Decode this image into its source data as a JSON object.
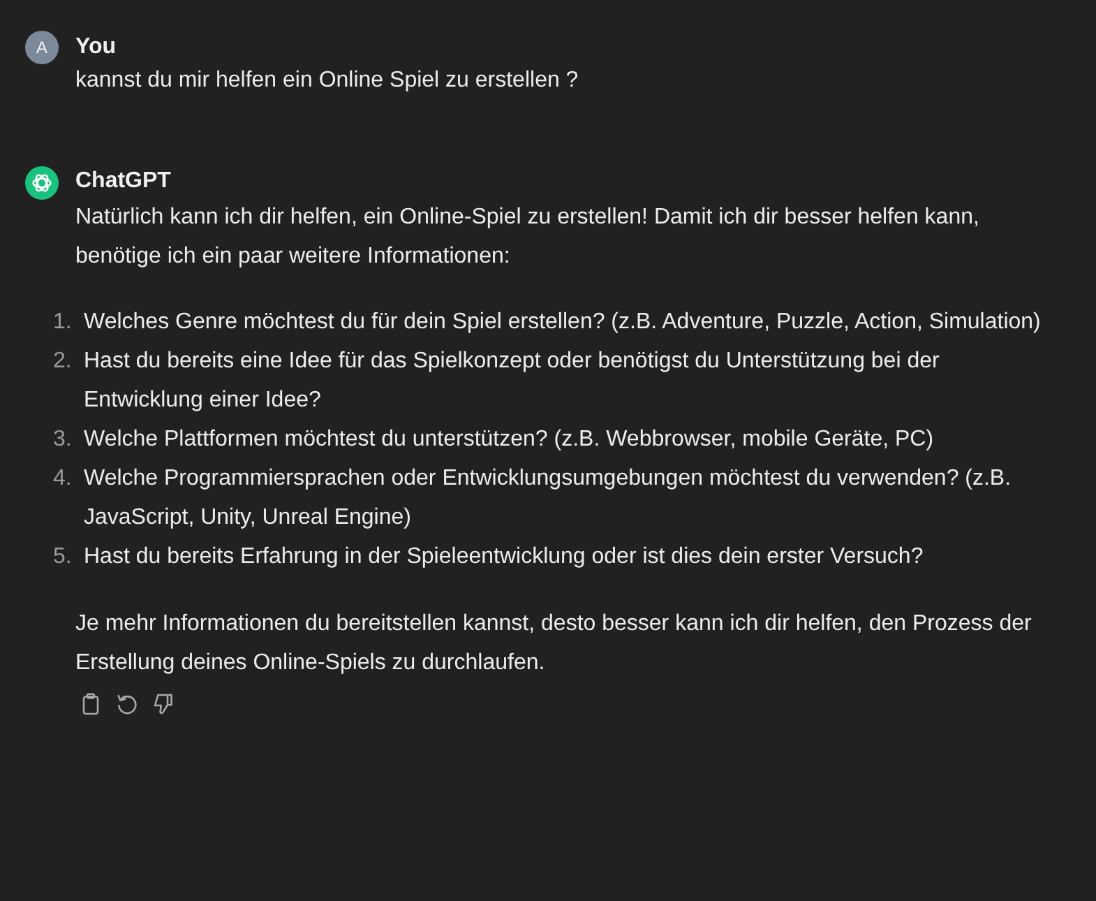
{
  "messages": [
    {
      "kind": "user",
      "author": "You",
      "avatar_letter": "A",
      "blocks": [
        {
          "kind": "paragraph",
          "text": "kannst du mir helfen ein Online Spiel zu erstellen ?"
        }
      ]
    },
    {
      "kind": "assistant",
      "author": "ChatGPT",
      "blocks": [
        {
          "kind": "paragraph",
          "text": "Natürlich kann ich dir helfen, ein Online-Spiel zu erstellen! Damit ich dir besser helfen kann, benötige ich ein paar weitere Informationen:"
        },
        {
          "kind": "list",
          "items": [
            {
              "number": "1.",
              "text": "Welches Genre möchtest du für dein Spiel erstellen? (z.B. Adventure, Puzzle, Action, Simulation)"
            },
            {
              "number": "2.",
              "text": "Hast du bereits eine Idee für das Spielkonzept oder benötigst du Unterstützung bei der Entwicklung einer Idee?"
            },
            {
              "number": "3.",
              "text": "Welche Plattformen möchtest du unterstützen? (z.B. Webbrowser, mobile Geräte, PC)"
            },
            {
              "number": "4.",
              "text": "Welche Programmiersprachen oder Entwicklungsumgebungen möchtest du verwenden? (z.B. JavaScript, Unity, Unreal Engine)"
            },
            {
              "number": "5.",
              "text": "Hast du bereits Erfahrung in der Spieleentwicklung oder ist dies dein erster Versuch?"
            }
          ]
        },
        {
          "kind": "paragraph",
          "text": "Je mehr Informationen du bereitstellen kannst, desto besser kann ich dir helfen, den Prozess der Erstellung deines Online-Spiels zu durchlaufen."
        }
      ],
      "actions": [
        {
          "kind": "copy"
        },
        {
          "kind": "regenerate"
        },
        {
          "kind": "dislike"
        }
      ]
    }
  ]
}
